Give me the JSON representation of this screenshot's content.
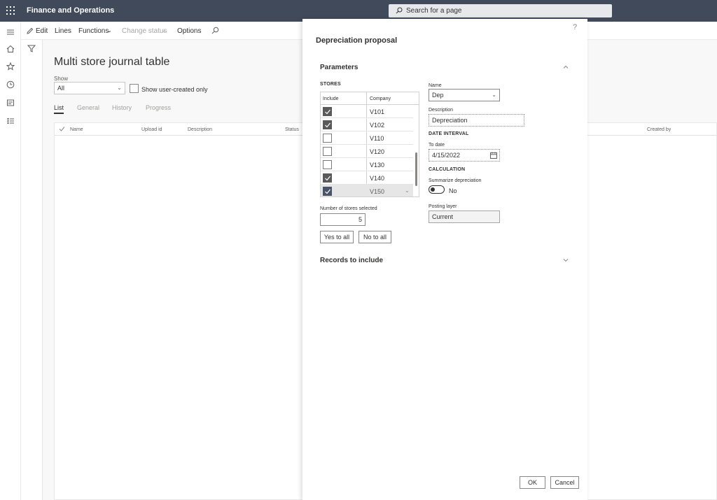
{
  "app": {
    "title": "Finance and Operations",
    "search_placeholder": "Search for a page"
  },
  "actions": {
    "edit": "Edit",
    "lines": "Lines",
    "functions": "Functions",
    "change_status": "Change status",
    "options": "Options"
  },
  "page": {
    "title": "Multi store journal table",
    "show_label": "Show",
    "show_value": "All",
    "show_user_created": "Show user-created only",
    "tabs": [
      "List",
      "General",
      "History",
      "Progress"
    ],
    "columns": {
      "name": "Name",
      "upload_id": "Upload id",
      "description": "Description",
      "status": "Status",
      "created_by": "Created by"
    }
  },
  "dialog": {
    "title": "Depreciation proposal",
    "help": "?",
    "parameters": "Parameters",
    "stores_label": "STORES",
    "stores_columns": {
      "include": "Include",
      "company": "Company"
    },
    "stores": [
      {
        "company": "V101",
        "include": true
      },
      {
        "company": "V102",
        "include": true
      },
      {
        "company": "V110",
        "include": false
      },
      {
        "company": "V120",
        "include": false
      },
      {
        "company": "V130",
        "include": false
      },
      {
        "company": "V140",
        "include": true
      },
      {
        "company": "V150",
        "include": true
      }
    ],
    "num_selected_label": "Number of stores selected",
    "num_selected": "5",
    "yes_to_all": "Yes to all",
    "no_to_all": "No to all",
    "name_label": "Name",
    "name_value": "Dep",
    "description_label": "Description",
    "description_value": "Depreciation",
    "date_interval_label": "DATE INTERVAL",
    "to_date_label": "To date",
    "to_date_value": "4/15/2022",
    "calculation_label": "CALCULATION",
    "summarize_label": "Summarize depreciation",
    "summarize_value": "No",
    "posting_layer_label": "Posting layer",
    "posting_layer_value": "Current",
    "records_to_include": "Records to include",
    "ok": "OK",
    "cancel": "Cancel"
  }
}
